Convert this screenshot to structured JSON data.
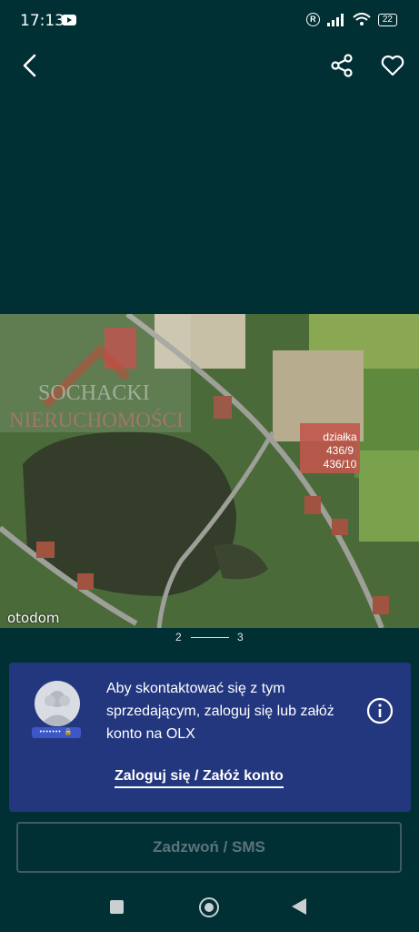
{
  "status_bar": {
    "time": "17:13",
    "battery": "22",
    "icons": [
      "youtube-icon",
      "registered-icon",
      "signal-icon",
      "wifi-icon",
      "battery-icon"
    ]
  },
  "header": {
    "icons": [
      "back-arrow-icon",
      "share-icon",
      "heart-icon"
    ]
  },
  "photo": {
    "brand": "otodom",
    "watermark_line1": "SOCHACKI",
    "watermark_line2": "NIERUCHOMOŚCI",
    "plot_label": [
      "działka",
      "436/9",
      "436/10"
    ]
  },
  "pager": {
    "current": "2",
    "next": "3"
  },
  "login_card": {
    "message": "Aby skontaktować się z tym sprzedającym, zaloguj się lub załóż konto na OLX",
    "link": "Zaloguj się / Załóż konto",
    "password_chip": "••••••• 🔒",
    "background": "#23377f"
  },
  "call_button": {
    "label": "Zadzwoń / SMS"
  },
  "colors": {
    "page_bg": "#002f34",
    "card_bg": "#23377f"
  }
}
